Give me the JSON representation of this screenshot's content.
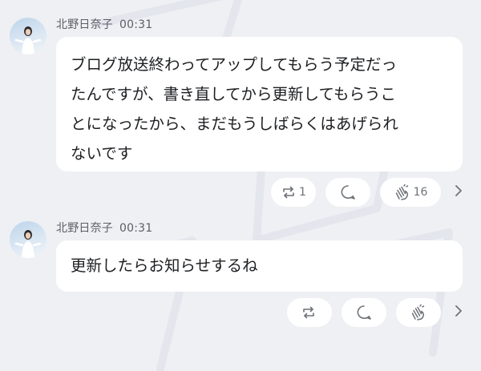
{
  "messages": [
    {
      "author": "北野日奈子",
      "time": "00:31",
      "lines": [
        "ブログ放送終わってアップしてもらう予定だっ",
        "たんですが、書き直してから更新してもらうこ",
        "とになったから、まだもうしばらくはあげられ",
        "ないです"
      ],
      "reactions": {
        "repost_count": "1",
        "comment_count": "",
        "clap_count": "16"
      }
    },
    {
      "author": "北野日奈子",
      "time": "00:31",
      "lines": [
        "更新したらお知らせするね"
      ],
      "reactions": {
        "repost_count": "",
        "comment_count": "",
        "clap_count": ""
      }
    }
  ],
  "icons": {
    "repost": "repost-icon",
    "comment": "comment-icon",
    "clap": "clap-icon",
    "more": "chevron-right-icon"
  },
  "colors": {
    "background": "#eef0f4",
    "bubble": "#ffffff",
    "text": "#1d1f22",
    "meta_text": "#5b5f66",
    "icon": "#6e7278"
  }
}
